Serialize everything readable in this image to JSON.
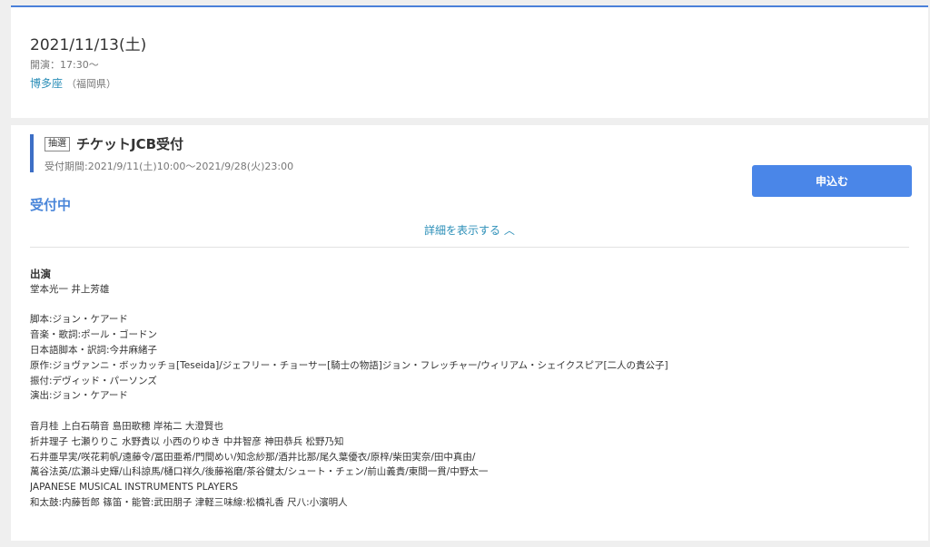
{
  "event": {
    "date": "2021/11/13(土)",
    "start_time": "開演：17:30〜",
    "venue_name": "博多座",
    "venue_pref": "（福岡県）"
  },
  "lottery": {
    "method_badge": "抽選",
    "title": "チケットJCB受付",
    "period": "受付期間:2021/9/11(土)10:00〜2021/9/28(火)23:00",
    "status": "受付中",
    "apply_label": "申込む",
    "details_label": "詳細を表示する ︿"
  },
  "cast": {
    "heading": "出演",
    "leads": "堂本光一 井上芳雄",
    "credits": [
      "脚本:ジョン・ケアード",
      "音楽・歌詞:ポール・ゴードン",
      "日本語脚本・訳詞:今井麻緒子",
      "原作:ジョヴァンニ・ボッカッチョ[Teseida]/ジェフリー・チョーサー[騎士の物語]ジョン・フレッチャー/ウィリアム・シェイクスピア[二人の貴公子]",
      "振付:デヴィッド・パーソンズ",
      "演出:ジョン・ケアード"
    ],
    "ensemble": [
      "音月桂 上白石萌音 島田歌穂 岸祐二 大澄賢也",
      "折井理子 七瀬りりこ 水野貴以 小西のりゆき 中井智彦 神田恭兵 松野乃知",
      "石井亜早実/咲花莉帆/遠藤令/冨田亜希/門間めい/知念紗那/酒井比那/尾久葉優衣/原梓/柴田実奈/田中真由/",
      "萬谷法英/広瀬斗史輝/山科諒馬/樋口祥久/後藤裕磨/茶谷健太/シュート・チェン/前山義貴/東間一貫/中野太一",
      "JAPANESE MUSICAL INSTRUMENTS PLAYERS",
      "和太鼓:内藤哲郎 篠笛・能管:武田朋子 津軽三味線:松橋礼香 尺八:小濱明人"
    ]
  },
  "colors": {
    "accent": "#4a86e8",
    "link": "#2c8fb8",
    "status": "#4a86d9",
    "page_bg": "#efefef"
  }
}
